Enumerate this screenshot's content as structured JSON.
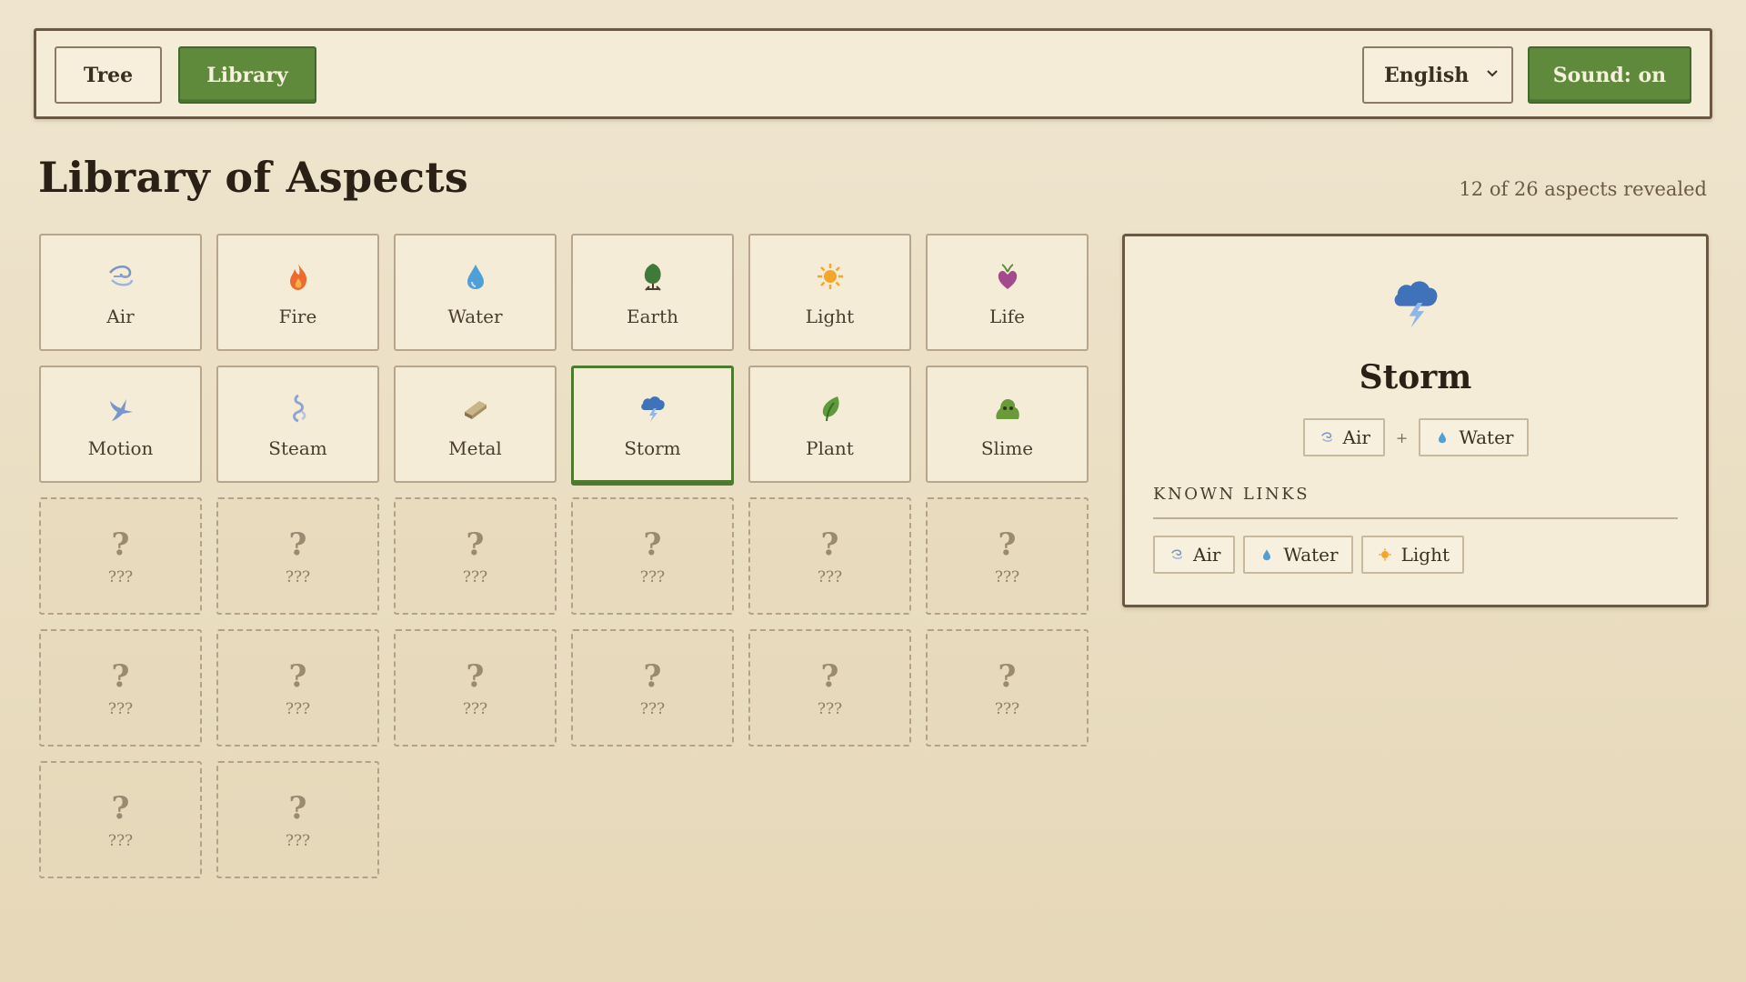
{
  "nav": {
    "tree_label": "Tree",
    "library_label": "Library",
    "language": "English",
    "sound_label": "Sound: on"
  },
  "page": {
    "title": "Library of Aspects",
    "revealed_text": "12 of 26 aspects revealed"
  },
  "aspects": [
    {
      "label": "Air",
      "icon": "air-icon"
    },
    {
      "label": "Fire",
      "icon": "fire-icon"
    },
    {
      "label": "Water",
      "icon": "water-icon"
    },
    {
      "label": "Earth",
      "icon": "earth-icon"
    },
    {
      "label": "Light",
      "icon": "light-icon"
    },
    {
      "label": "Life",
      "icon": "life-icon"
    },
    {
      "label": "Motion",
      "icon": "motion-icon"
    },
    {
      "label": "Steam",
      "icon": "steam-icon"
    },
    {
      "label": "Metal",
      "icon": "metal-icon"
    },
    {
      "label": "Storm",
      "icon": "storm-icon"
    },
    {
      "label": "Plant",
      "icon": "plant-icon"
    },
    {
      "label": "Slime",
      "icon": "slime-icon"
    }
  ],
  "locked": {
    "mark": "?",
    "label": "???"
  },
  "detail": {
    "name": "Storm",
    "icon": "storm-icon",
    "recipe": [
      {
        "label": "Air",
        "icon": "air-icon"
      },
      {
        "label": "Water",
        "icon": "water-icon"
      }
    ],
    "plus": "+",
    "known_links_title": "KNOWN LINKS",
    "known_links": [
      {
        "label": "Air",
        "icon": "air-icon"
      },
      {
        "label": "Water",
        "icon": "water-icon"
      },
      {
        "label": "Light",
        "icon": "light-icon"
      }
    ]
  },
  "colors": {
    "accent_green": "#5f8a3c",
    "panel": "#f5ecd7",
    "border_dark": "#6b5842"
  }
}
